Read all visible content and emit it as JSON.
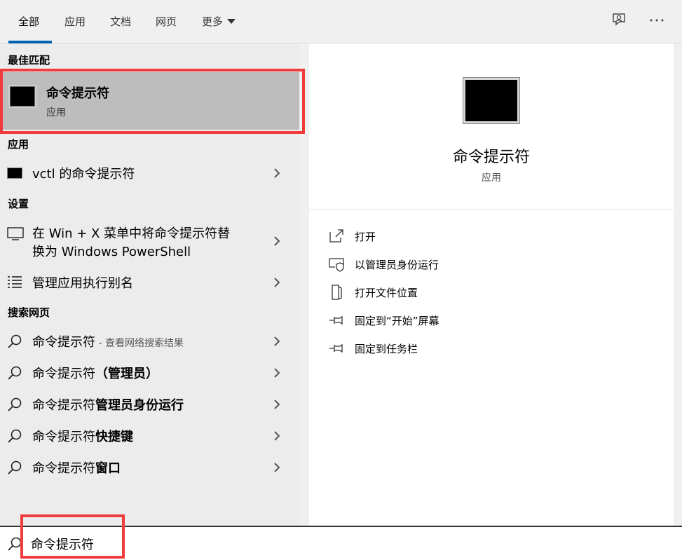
{
  "tabs": [
    {
      "label": "全部"
    },
    {
      "label": "应用"
    },
    {
      "label": "文档"
    },
    {
      "label": "网页"
    },
    {
      "label": "更多"
    }
  ],
  "sections": {
    "best_match": "最佳匹配",
    "apps": "应用",
    "settings": "设置",
    "web": "搜索网页"
  },
  "best_match": {
    "title": "命令提示符",
    "subtitle": "应用"
  },
  "apps": [
    {
      "label": "vctl 的命令提示符"
    }
  ],
  "settings": [
    {
      "line1": "在 Win + X 菜单中将命令提示符替",
      "line2": "换为 Windows PowerShell"
    },
    {
      "line1": "管理应用执行别名"
    }
  ],
  "web": [
    {
      "normal": "命令提示符",
      "hint": " - 查看网络搜索结果"
    },
    {
      "normal": "命令提示符",
      "bold": "（管理员）"
    },
    {
      "normal": "命令提示符",
      "bold": "管理员身份运行"
    },
    {
      "normal": "命令提示符",
      "bold": "快捷键"
    },
    {
      "normal": "命令提示符",
      "bold": "窗口"
    }
  ],
  "detail": {
    "title": "命令提示符",
    "subtitle": "应用",
    "actions": [
      {
        "label": "打开"
      },
      {
        "label": "以管理员身份运行"
      },
      {
        "label": "打开文件位置"
      },
      {
        "label": "固定到“开始”屏幕"
      },
      {
        "label": "固定到任务栏"
      }
    ]
  },
  "search": {
    "value": "命令提示符"
  },
  "colors": {
    "accent": "#0063b1",
    "highlight": "#f03c3c"
  }
}
